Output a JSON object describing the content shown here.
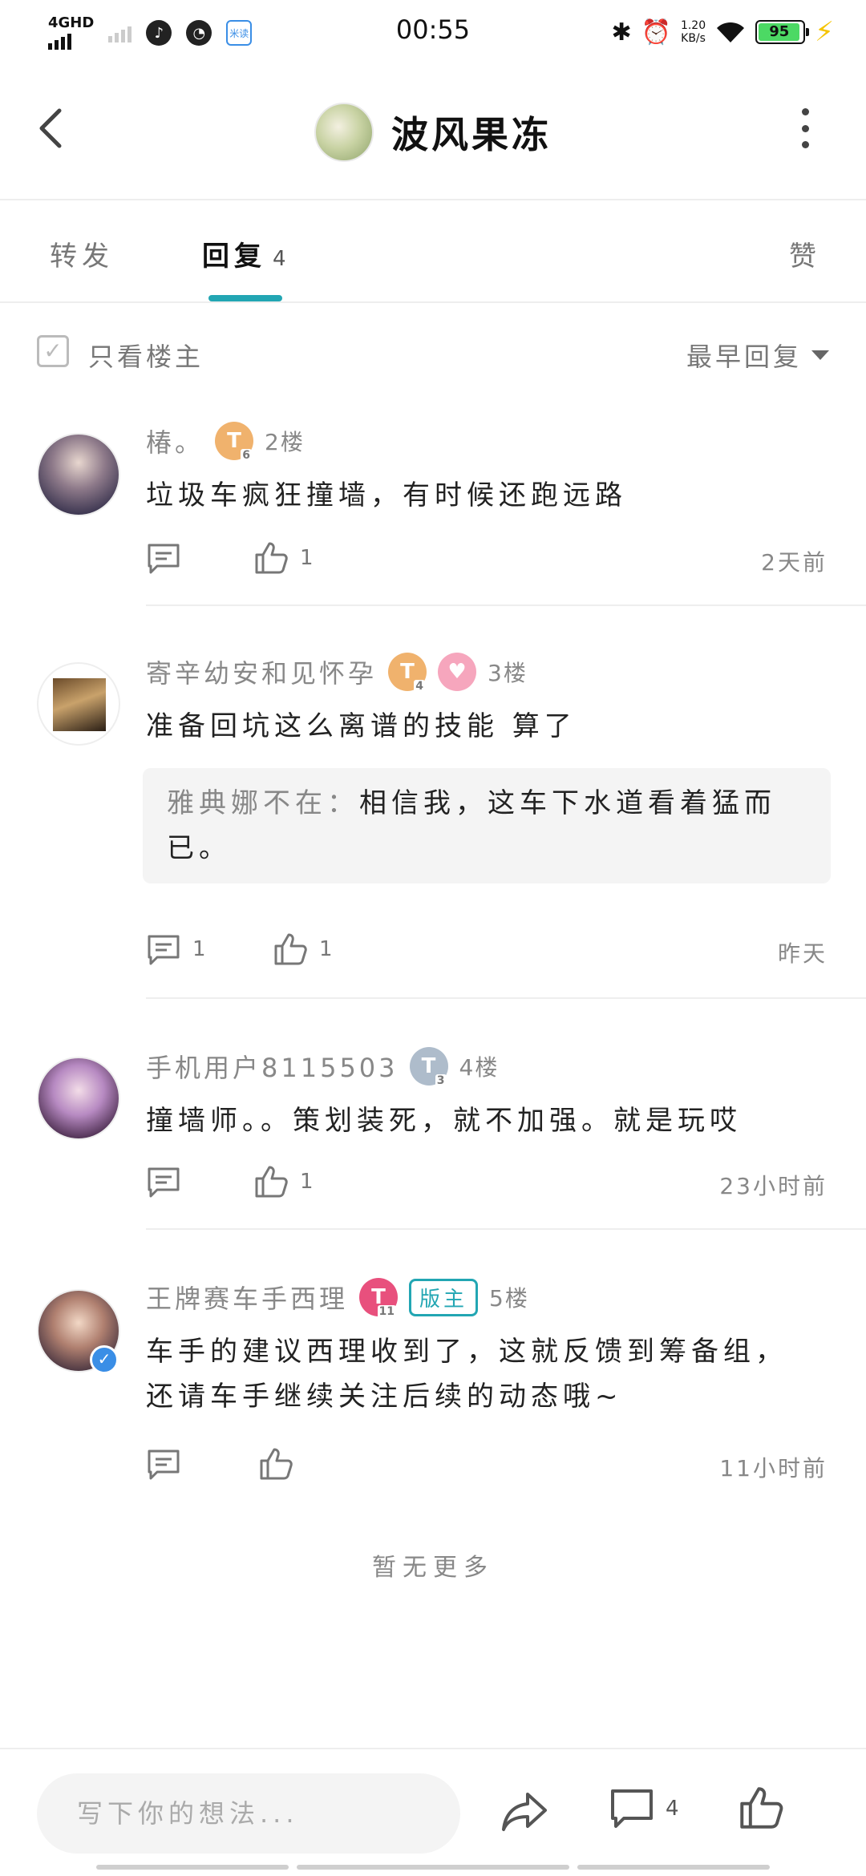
{
  "status_bar": {
    "network": "4GHD",
    "app_badge": "米读",
    "time": "00:55",
    "speed_value": "1.20",
    "speed_unit": "KB/s",
    "battery": "95",
    "battery_level": 0.95
  },
  "header": {
    "title": "波风果冻"
  },
  "tabs": [
    {
      "label": "转发",
      "count": ""
    },
    {
      "label": "回复",
      "count": "4"
    },
    {
      "label": "赞",
      "count": ""
    }
  ],
  "active_tab": "回复",
  "filter": {
    "only_op_label": "只看楼主",
    "sort_label": "最早回复"
  },
  "replies": [
    {
      "username": "椿。",
      "level": "T",
      "level_num": "6",
      "floor": "2楼",
      "content": "垃圾车疯狂撞墙，有时候还跑远路",
      "comment_count": "",
      "like_count": "1",
      "time": "2天前"
    },
    {
      "username": "寄辛幼安和见怀孕",
      "level": "T",
      "level_num": "4",
      "floor": "3楼",
      "content": "准备回坑这么离谱的技能 算了",
      "quote_name": "雅典娜不在：",
      "quote_text": "相信我，这车下水道看着猛而已。",
      "comment_count": "1",
      "like_count": "1",
      "time": "昨天"
    },
    {
      "username": "手机用户8115503",
      "level": "T",
      "level_num": "3",
      "floor": "4楼",
      "content": "撞墙师。。策划装死，就不加强。就是玩哎",
      "comment_count": "",
      "like_count": "1",
      "time": "23小时前"
    },
    {
      "username": "王牌赛车手西理",
      "level": "T",
      "level_num": "11",
      "mod_badge": "版主",
      "floor": "5楼",
      "content_line1": "车手的建议西理收到了，这就反馈到筹备组，",
      "content_line2": "还请车手继续关注后续的动态哦~",
      "comment_count": "",
      "like_count": "",
      "time": "11小时前"
    }
  ],
  "no_more": "暂无更多",
  "bottom_bar": {
    "input_placeholder": "写下你的想法...",
    "comment_count": "4"
  }
}
